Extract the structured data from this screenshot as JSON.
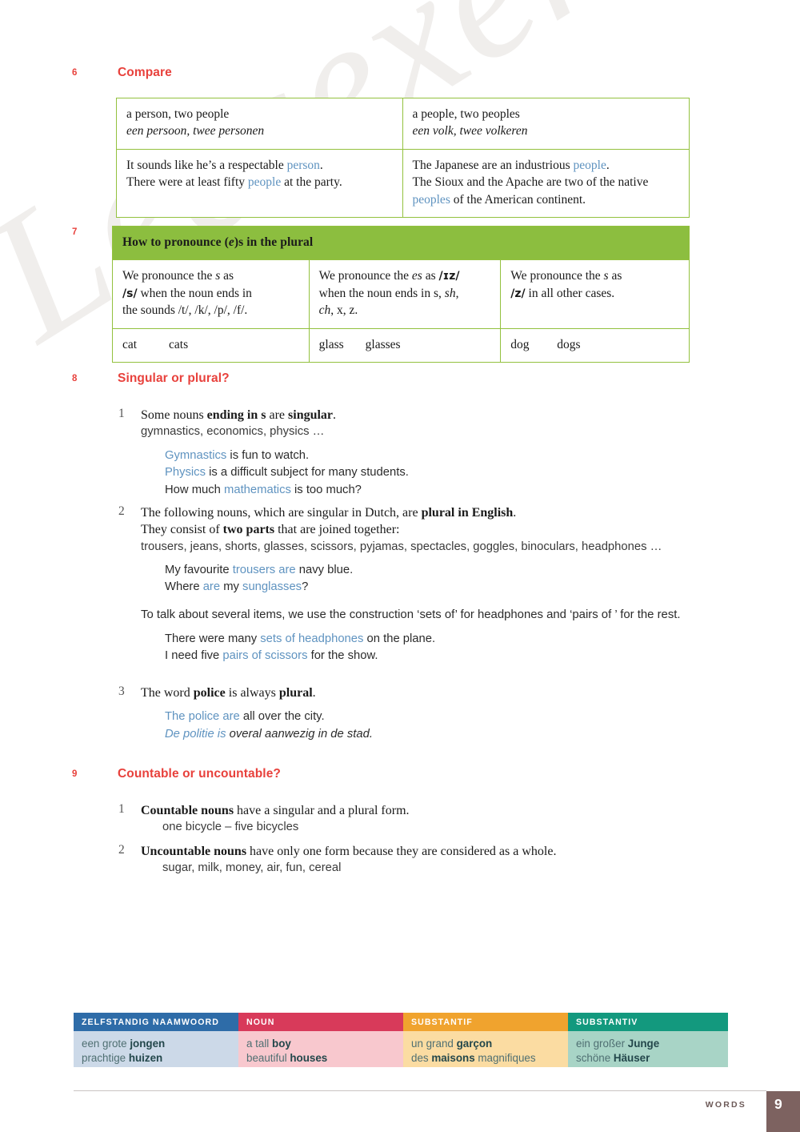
{
  "watermark": "Leesexemplaar",
  "sections": [
    {
      "number": "6",
      "title": "Compare"
    },
    {
      "number": "7",
      "title": ""
    },
    {
      "number": "8",
      "title": "Singular or plural?"
    },
    {
      "number": "9",
      "title": "Countable or uncountable?"
    }
  ],
  "compare_table": {
    "row1": {
      "left_en": "a person, two people",
      "left_nl": "een persoon, twee personen",
      "right_en": "a people, two peoples",
      "right_nl": "een volk, twee volkeren"
    },
    "row2": {
      "left_lines": [
        {
          "pre": "It sounds like he’s a respectable ",
          "hl": "person",
          "post": "."
        },
        {
          "pre": "There were at least fifty ",
          "hl": "people",
          "post": " at the party."
        }
      ],
      "right_lines": [
        {
          "pre": "The Japanese are an industrious ",
          "hl": "people",
          "post": "."
        },
        {
          "pre": "The Sioux and the Apache are two of the native",
          "hl": "",
          "post": ""
        },
        {
          "pre": "",
          "hl": "peoples",
          "post": " of the American continent."
        }
      ]
    }
  },
  "pronounce_table": {
    "header_pre": "How to pronounce (",
    "header_italic": "e",
    "header_post": ")s in the plural",
    "columns": [
      {
        "rule_html": "We pronounce the <span class=\"it\">s</span> as<br><span class=\"ipa\">/s/</span> when the noun ends in<br>the sounds /t/, /k/, /p/, /f/.",
        "singular": "cat",
        "plural": "cats"
      },
      {
        "rule_html": "We pronounce the <span class=\"it\">es</span> as <span class=\"ipa\">/ɪz/</span><br>when the noun ends in s, <span class=\"it\">sh</span>,<br><span class=\"it\">ch</span>, x, z.",
        "singular": "glass",
        "plural": "glasses"
      },
      {
        "rule_html": "We pronounce the <span class=\"it\">s</span> as<br><span class=\"ipa\">/z/</span> in all other cases.",
        "singular": "dog",
        "plural": "dogs"
      }
    ]
  },
  "singular_plural": {
    "items": [
      {
        "num": "1",
        "rule_html": "Some nouns <b>ending in s</b> are <b>singular</b>.",
        "word_list": "gymnastics, economics, physics …",
        "examples_html": "<span class=\"blue\">Gymnastics</span> is fun to watch.<br><span class=\"blue\">Physics</span> is a difficult subject for many students.<br>How much <span class=\"blue\">mathematics</span> is too much?"
      },
      {
        "num": "2",
        "rule_html": "The following nouns, which are singular in Dutch, are <b>plural in English</b>.<br>They consist of <b>two parts</b> that are joined together:",
        "word_list": "trousers, jeans, shorts, glasses, scissors, pyjamas, spectacles, goggles, binoculars, headphones …",
        "examples_html": "My favourite <span class=\"blue\">trousers are</span> navy blue.<br>Where <span class=\"blue\">are</span> my <span class=\"blue\">sunglasses</span>?",
        "paragraph": "To talk about several items, we use the construction ‘sets of’ for headphones and ‘pairs of ’ for the rest.",
        "examples2_html": "There were many <span class=\"blue\">sets of headphones</span> on the plane.<br>I need five <span class=\"blue\">pairs of scissors</span> for the show."
      },
      {
        "num": "3",
        "rule_html": "The word <b>police</b> is always <b>plural</b>.",
        "examples_html": "<span class=\"blue\">The police are</span> all over the city.<br><span class=\"blue nl\">De politie is</span> <span class=\"nl\">overal aanwezig in de stad.</span>"
      }
    ]
  },
  "countable": {
    "items": [
      {
        "num": "1",
        "rule_html": "<b>Countable nouns</b> have a singular and a plural form.",
        "word_list": "one bicycle – five bicycles"
      },
      {
        "num": "2",
        "rule_html": "<b>Uncountable nouns</b> have only one form because they are considered as a whole.",
        "word_list": "sugar, milk, money, air, fun, cereal"
      }
    ]
  },
  "vocab_table": {
    "columns": [
      {
        "header": "ZELFSTANDIG NAAMWOORD",
        "header_color": "#2e6ca8",
        "body_color": "#ccd9e8",
        "lines_html": "een grote <b>jongen</b><br>prachtige <b>huizen</b>"
      },
      {
        "header": "NOUN",
        "header_color": "#d83a5a",
        "body_color": "#f8c8ce",
        "lines_html": "a tall <b>boy</b><br>beautiful <b>houses</b>"
      },
      {
        "header": "SUBSTANTIF",
        "header_color": "#f0a32e",
        "body_color": "#fbdca2",
        "lines_html": "un grand <b>garçon</b><br>des <b>maisons</b> magnifiques"
      },
      {
        "header": "SUBSTANTIV",
        "header_color": "#13997e",
        "body_color": "#a8d4c6",
        "lines_html": "ein großer <b>Junge</b><br>schöne <b>Häuser</b>"
      }
    ]
  },
  "footer": {
    "label": "WORDS",
    "page_number": "9"
  }
}
